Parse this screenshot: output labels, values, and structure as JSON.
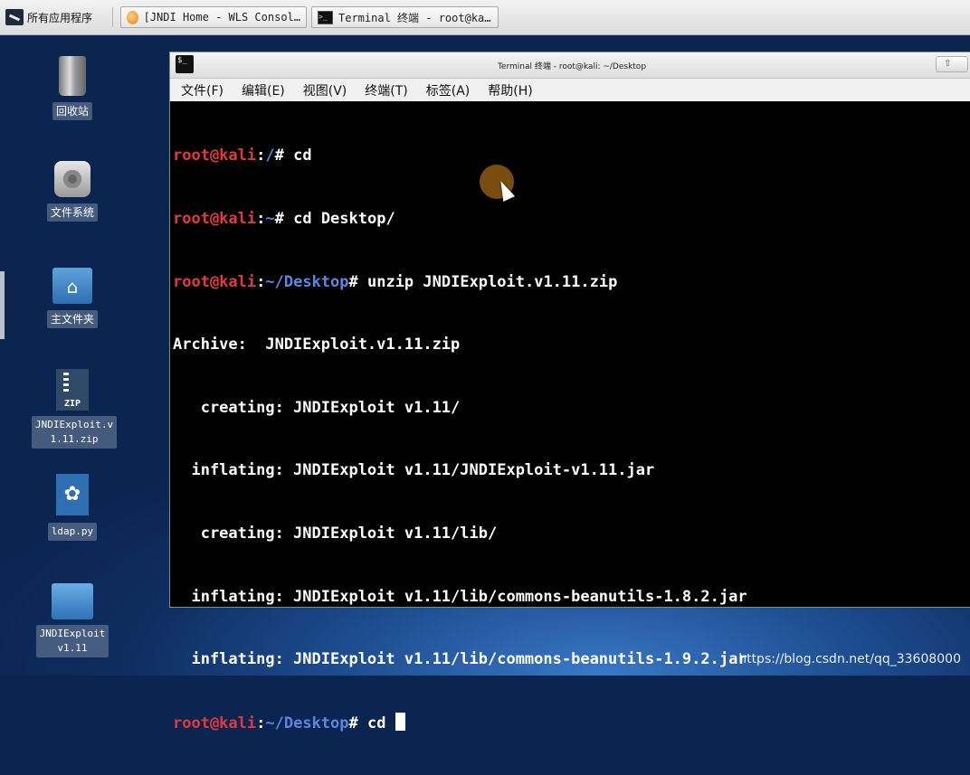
{
  "taskbar": {
    "apps_menu_label": "所有应用程序",
    "tasks": [
      {
        "label": "[JNDI Home - WLS Consol…",
        "icon": "firefox-icon"
      },
      {
        "label": "Terminal 终端 - root@ka…",
        "icon": "terminal-icon"
      }
    ]
  },
  "desktop": {
    "icons": [
      {
        "label": "回收站",
        "icon": "trash-icon"
      },
      {
        "label": "文件系统",
        "icon": "disk-icon"
      },
      {
        "label": "主文件夹",
        "icon": "home-folder-icon"
      },
      {
        "label": "JNDIExploit.v\n1.11.zip",
        "icon": "zip-file-icon",
        "badge": "ZIP"
      },
      {
        "label": "ldap.py",
        "icon": "python-file-icon"
      },
      {
        "label": "JNDIExploit\nv1.11",
        "icon": "folder-icon"
      }
    ]
  },
  "terminal": {
    "title": "Terminal 终端 - root@kali: ~/Desktop",
    "menu": [
      "文件(F)",
      "编辑(E)",
      "视图(V)",
      "终端(T)",
      "标签(A)",
      "帮助(H)"
    ],
    "lines": [
      {
        "user": "root@kali",
        "sep": ":",
        "path": "/",
        "prompt": "# ",
        "cmd": "cd"
      },
      {
        "user": "root@kali",
        "sep": ":",
        "path": "~",
        "prompt": "# ",
        "cmd": "cd Desktop/"
      },
      {
        "user": "root@kali",
        "sep": ":",
        "path": "~/Desktop",
        "prompt": "# ",
        "cmd": "unzip JNDIExploit.v1.11.zip"
      },
      {
        "text": "Archive:  JNDIExploit.v1.11.zip"
      },
      {
        "text": "   creating: JNDIExploit v1.11/"
      },
      {
        "text": "  inflating: JNDIExploit v1.11/JNDIExploit-v1.11.jar"
      },
      {
        "text": "   creating: JNDIExploit v1.11/lib/"
      },
      {
        "text": "  inflating: JNDIExploit v1.11/lib/commons-beanutils-1.8.2.jar"
      },
      {
        "text": "  inflating: JNDIExploit v1.11/lib/commons-beanutils-1.9.2.jar"
      },
      {
        "user": "root@kali",
        "sep": ":",
        "path": "~/Desktop",
        "prompt": "# ",
        "cmd": "cd "
      }
    ]
  },
  "watermark": "https://blog.csdn.net/qq_33608000",
  "colors": {
    "user": "#e5383c",
    "path": "#5b87e0",
    "terminal_bg": "#000000"
  }
}
